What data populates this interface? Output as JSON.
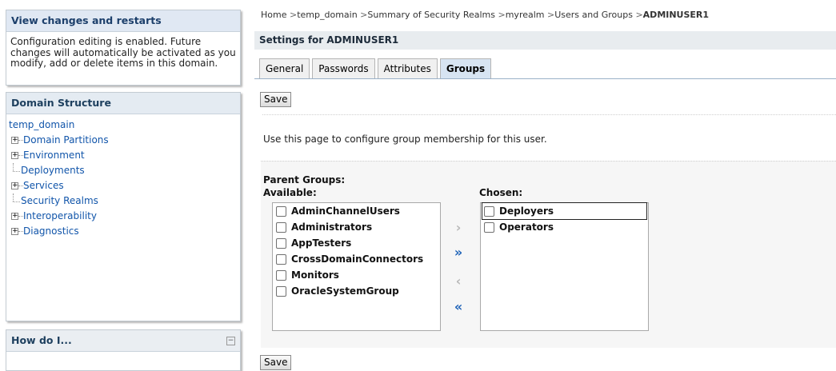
{
  "sidebar": {
    "change_center": {
      "title": "View changes and restarts",
      "message": "Configuration editing is enabled. Future changes will automatically be activated as you modify, add or delete items in this domain."
    },
    "domain_structure": {
      "title": "Domain Structure",
      "root": "temp_domain",
      "items": [
        {
          "label": "Domain Partitions",
          "expandable": true
        },
        {
          "label": "Environment",
          "expandable": true
        },
        {
          "label": "Deployments",
          "expandable": false
        },
        {
          "label": "Services",
          "expandable": true
        },
        {
          "label": "Security Realms",
          "expandable": false
        },
        {
          "label": "Interoperability",
          "expandable": true
        },
        {
          "label": "Diagnostics",
          "expandable": true
        }
      ]
    },
    "how_do_i": {
      "title": "How do I..."
    }
  },
  "breadcrumb": {
    "items": [
      "Home",
      "temp_domain",
      "Summary of Security Realms",
      "myrealm",
      "Users and Groups"
    ],
    "current": "ADMINUSER1"
  },
  "settings_title": "Settings for ADMINUSER1",
  "tabs": [
    {
      "label": "General",
      "active": false
    },
    {
      "label": "Passwords",
      "active": false
    },
    {
      "label": "Attributes",
      "active": false
    },
    {
      "label": "Groups",
      "active": true
    }
  ],
  "buttons": {
    "save_top": "Save",
    "save_bottom": "Save"
  },
  "description": "Use this page to configure group membership for this user.",
  "parent_groups": {
    "title": "Parent Groups:",
    "available_label": "Available:",
    "chosen_label": "Chosen:",
    "available": [
      "AdminChannelUsers",
      "Administrators",
      "AppTesters",
      "CrossDomainConnectors",
      "Monitors",
      "OracleSystemGroup"
    ],
    "chosen": [
      "Deployers",
      "Operators"
    ]
  },
  "icons": {
    "move_right": "chevron-right-icon",
    "move_all_right": "double-chevron-right-icon",
    "move_left": "chevron-left-icon",
    "move_all_left": "double-chevron-left-icon"
  },
  "colors": {
    "link": "#1155aa",
    "accent_blue": "#1f63b8",
    "active_tab": "#d7e4f2"
  }
}
